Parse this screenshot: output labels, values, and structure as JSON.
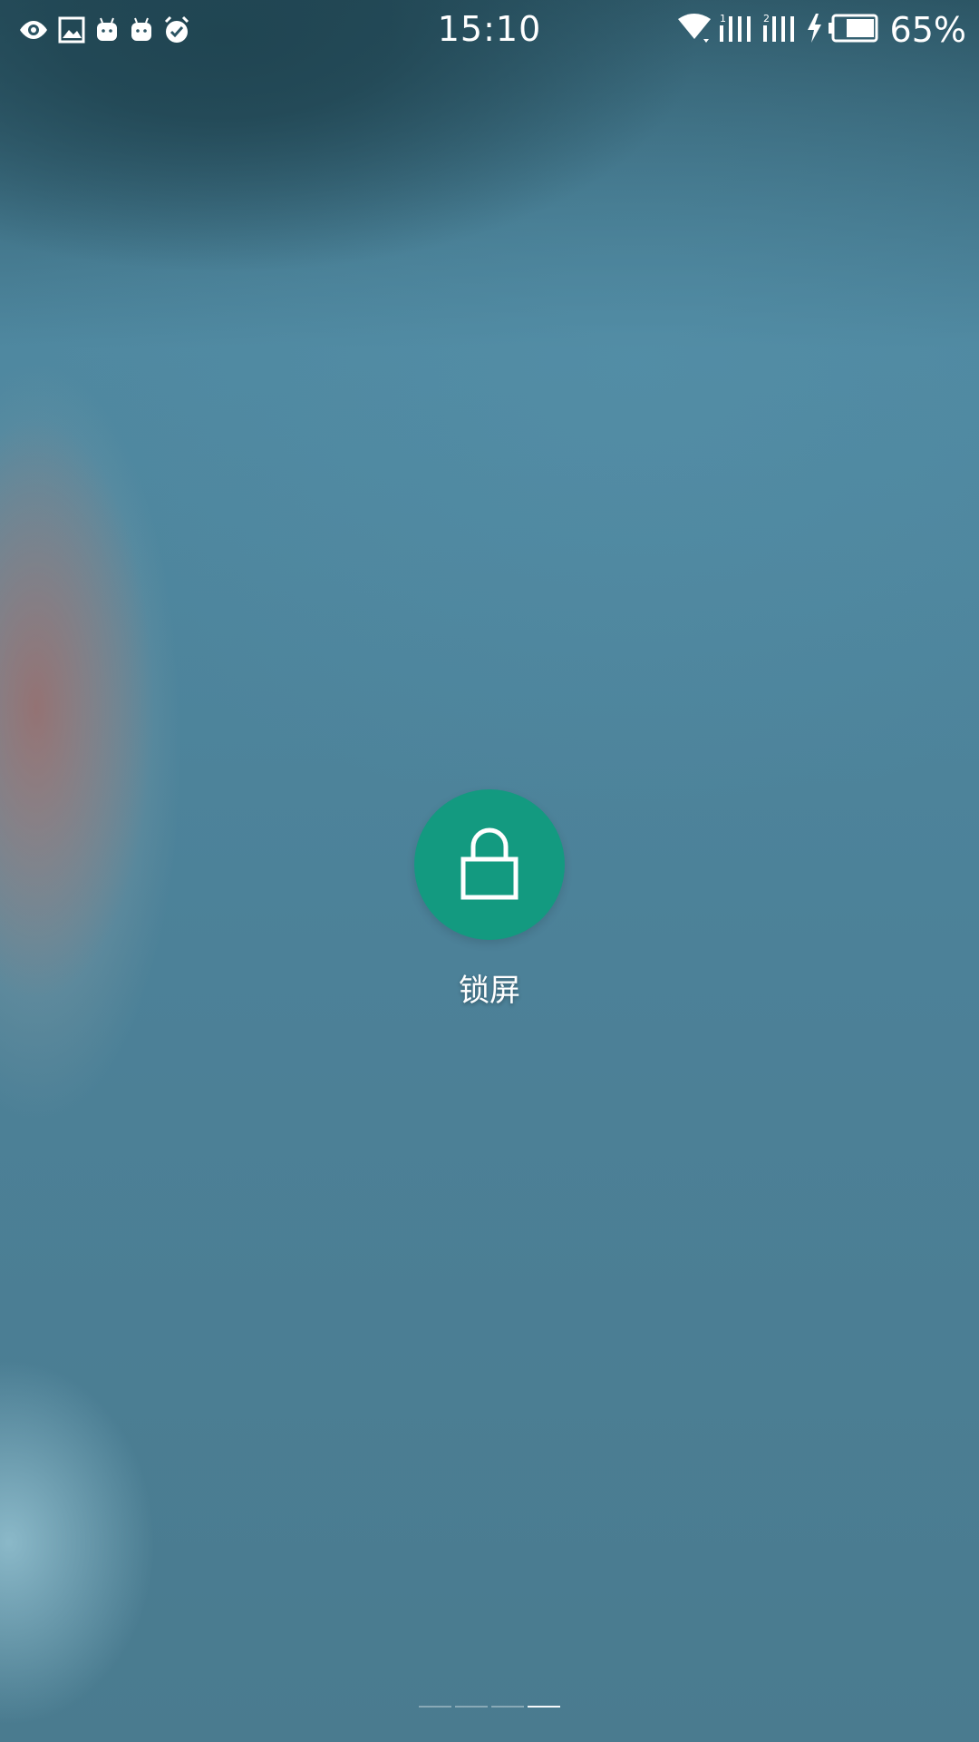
{
  "status_bar": {
    "time": "15:10",
    "battery_percent": "65%",
    "left_icons": [
      "eye-icon",
      "image-icon",
      "android-icon",
      "android-icon",
      "alarm-check-icon"
    ],
    "right_icons": [
      "wifi-icon",
      "signal-sim1-icon",
      "signal-sim2-icon",
      "charging-icon",
      "battery-icon"
    ],
    "sim1_label": "1",
    "sim2_label": "2"
  },
  "lock_action": {
    "label": "锁屏",
    "icon": "lock-icon",
    "circle_color": "#139a80"
  },
  "page_indicator": {
    "count": 4,
    "active_index": 3
  }
}
